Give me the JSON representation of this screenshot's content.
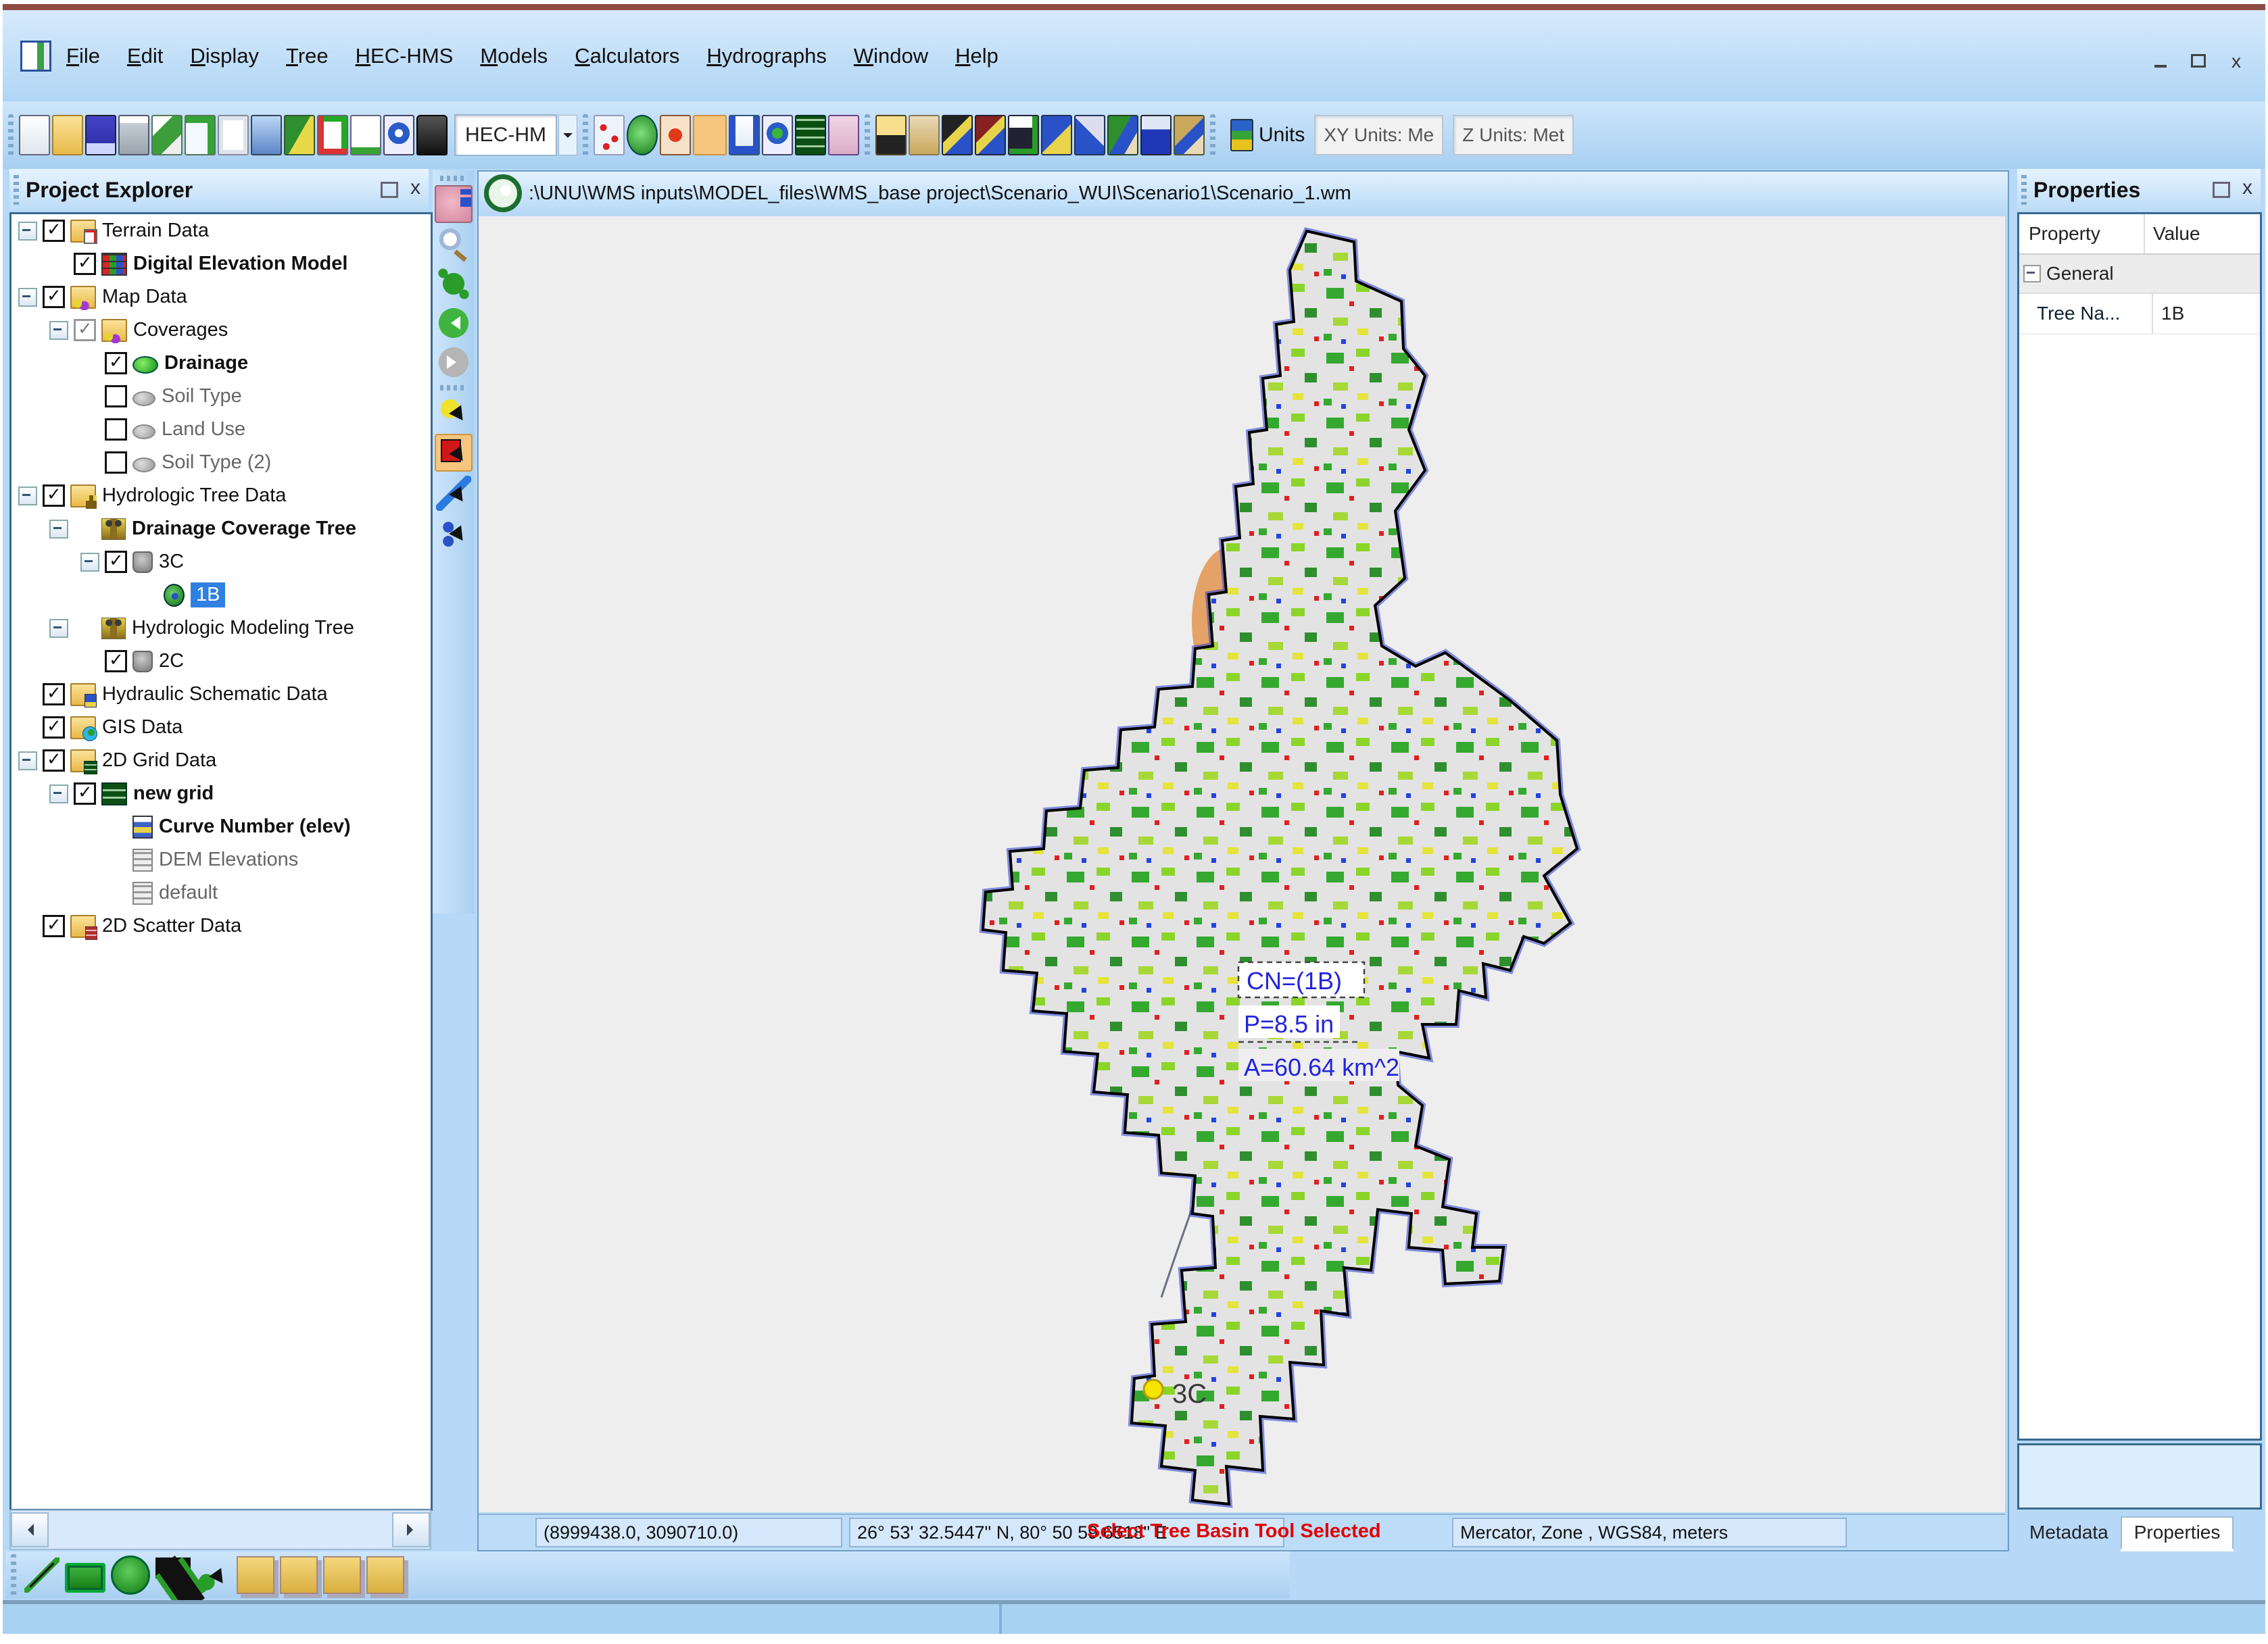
{
  "window": {
    "controls": {
      "minimize": "-",
      "restore": "□",
      "close": "x"
    }
  },
  "menu_bar": {
    "items": [
      "File",
      "Edit",
      "Display",
      "Tree",
      "HEC-HMS",
      "Models",
      "Calculators",
      "Hydrographs",
      "Window",
      "Help"
    ]
  },
  "toolbar": {
    "hechm_dropdown": "HEC-HM",
    "units_button_label": "Units",
    "xy_units_readout": "XY Units: Me",
    "z_units_readout": "Z Units: Met"
  },
  "project_explorer": {
    "title": "Project Explorer",
    "tree": [
      {
        "label": "Terrain Data",
        "level": 0,
        "checkbox": "checked",
        "icon": "terrain-folder",
        "expander": true
      },
      {
        "label": "Digital Elevation Model",
        "level": 1,
        "checkbox": "checked",
        "icon": "dem",
        "bold": true
      },
      {
        "label": "Map Data",
        "level": 0,
        "checkbox": "checked",
        "icon": "map-folder",
        "expander": true
      },
      {
        "label": "Coverages",
        "level": 1,
        "checkbox": "gray",
        "icon": "coverages",
        "expander": true
      },
      {
        "label": "Drainage",
        "level": 2,
        "checkbox": "checked",
        "icon": "drainage",
        "bold": true
      },
      {
        "label": "Soil Type",
        "level": 2,
        "checkbox": "unchecked",
        "icon": "coverage-off",
        "dim": true
      },
      {
        "label": "Land Use",
        "level": 2,
        "checkbox": "unchecked",
        "icon": "coverage-off",
        "dim": true
      },
      {
        "label": "Soil Type (2)",
        "level": 2,
        "checkbox": "unchecked",
        "icon": "coverage-off",
        "dim": true
      },
      {
        "label": "Hydrologic Tree Data",
        "level": 0,
        "checkbox": "checked",
        "icon": "hydro-folder",
        "expander": true
      },
      {
        "label": "Drainage Coverage Tree",
        "level": 1,
        "checkbox": "none",
        "icon": "tree-model",
        "bold": true,
        "expander": true
      },
      {
        "label": "3C",
        "level": 2,
        "checkbox": "checked",
        "icon": "outlet",
        "expander": true
      },
      {
        "label": "1B",
        "level": 3,
        "checkbox": "none",
        "icon": "basin",
        "selected": true
      },
      {
        "label": "Hydrologic Modeling Tree",
        "level": 1,
        "checkbox": "none",
        "icon": "tree-model",
        "expander": true
      },
      {
        "label": "2C",
        "level": 2,
        "checkbox": "checked",
        "icon": "outlet"
      },
      {
        "label": "Hydraulic Schematic Data",
        "level": 0,
        "checkbox": "checked",
        "icon": "hydraulic-folder"
      },
      {
        "label": "GIS Data",
        "level": 0,
        "checkbox": "checked",
        "icon": "gis-folder"
      },
      {
        "label": "2D Grid Data",
        "level": 0,
        "checkbox": "checked",
        "icon": "grid-folder",
        "expander": true
      },
      {
        "label": "new grid",
        "level": 1,
        "checkbox": "checked",
        "icon": "grid",
        "bold": true,
        "expander": true
      },
      {
        "label": "Curve Number (elev)",
        "level": 2,
        "checkbox": "none",
        "icon": "dataset-active",
        "bold": true
      },
      {
        "label": "DEM Elevations",
        "level": 2,
        "checkbox": "none",
        "icon": "dataset",
        "dim": true
      },
      {
        "label": "default",
        "level": 2,
        "checkbox": "none",
        "icon": "dataset",
        "dim": true
      },
      {
        "label": "2D Scatter Data",
        "level": 0,
        "checkbox": "checked",
        "icon": "scatter-folder"
      }
    ]
  },
  "map_window": {
    "title_path": ":\\UNU\\WMS inputs\\MODEL_files\\WMS_base project\\Scenario_WUI\\Scenario1\\Scenario_1.wm",
    "basin_labels": {
      "cn": "CN=(1B)",
      "precip": "P=8.5 in",
      "area": "A=60.64 km^2",
      "outlet": "3C"
    },
    "status_bar": {
      "model_coords": "(8999438.0, 3090710.0)",
      "geo_coords": "26° 53' 32.5447\" N, 80° 50 59.6518\" E",
      "tool_message": "Select Tree Basin Tool Selected",
      "projection": "Mercator, Zone , WGS84, meters"
    }
  },
  "properties_panel": {
    "title": "Properties",
    "columns": {
      "property": "Property",
      "value": "Value"
    },
    "group_label": "General",
    "rows": [
      {
        "property": "Tree Na...",
        "value": "1B"
      }
    ],
    "tabs": {
      "metadata": "Metadata",
      "properties": "Properties"
    },
    "active_tab": "Properties"
  },
  "colors": {
    "selection_highlight": "#2f80e0",
    "tool_message_red": "#e00000",
    "basin_label_blue": "#2222dd",
    "top_bar_maroon": "#8e4b42",
    "ui_blue": "#b7d9f7"
  }
}
